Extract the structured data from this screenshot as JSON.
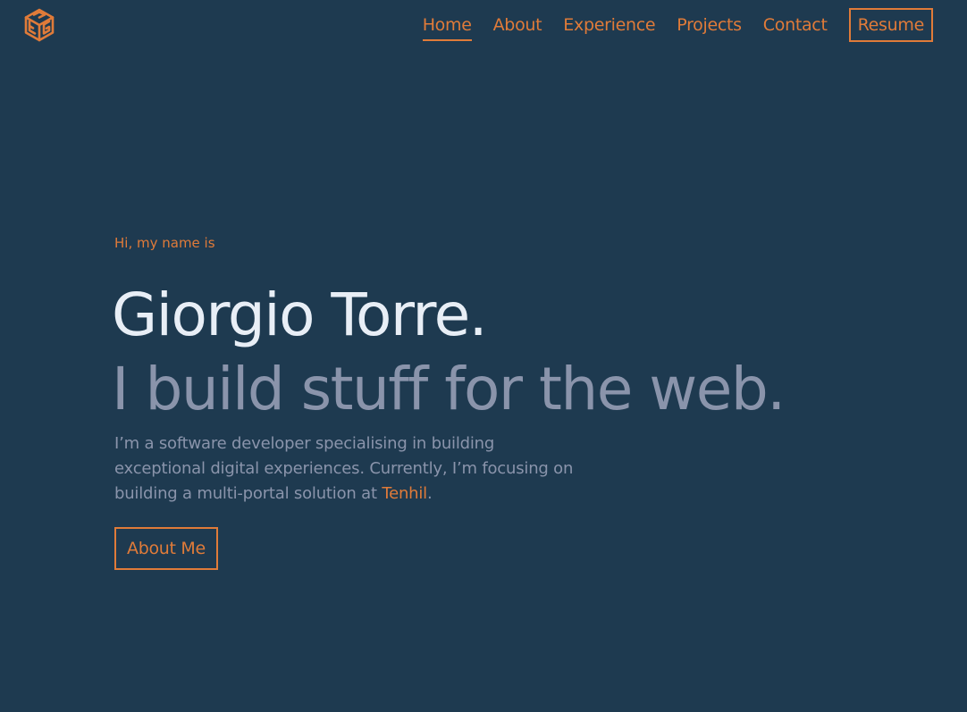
{
  "nav": {
    "logo_icon": "cube-logo-icon",
    "links": [
      {
        "label": "Home",
        "active": true
      },
      {
        "label": "About",
        "active": false
      },
      {
        "label": "Experience",
        "active": false
      },
      {
        "label": "Projects",
        "active": false
      },
      {
        "label": "Contact",
        "active": false
      }
    ],
    "resume_label": "Resume"
  },
  "hero": {
    "greeting": "Hi, my name is",
    "name": "Giorgio Torre.",
    "tagline": "I build stuff for the web.",
    "bio_before": "I’m a software developer specialising in building exceptional digital experiences. Currently, I’m focusing on building a multi-portal solution at ",
    "bio_link": "Tenhil",
    "bio_after": ".",
    "cta_label": "About Me"
  },
  "colors": {
    "background": "#1e3a50",
    "accent": "#e07b39",
    "heading": "#e8eef6",
    "muted": "#8a94ab"
  }
}
